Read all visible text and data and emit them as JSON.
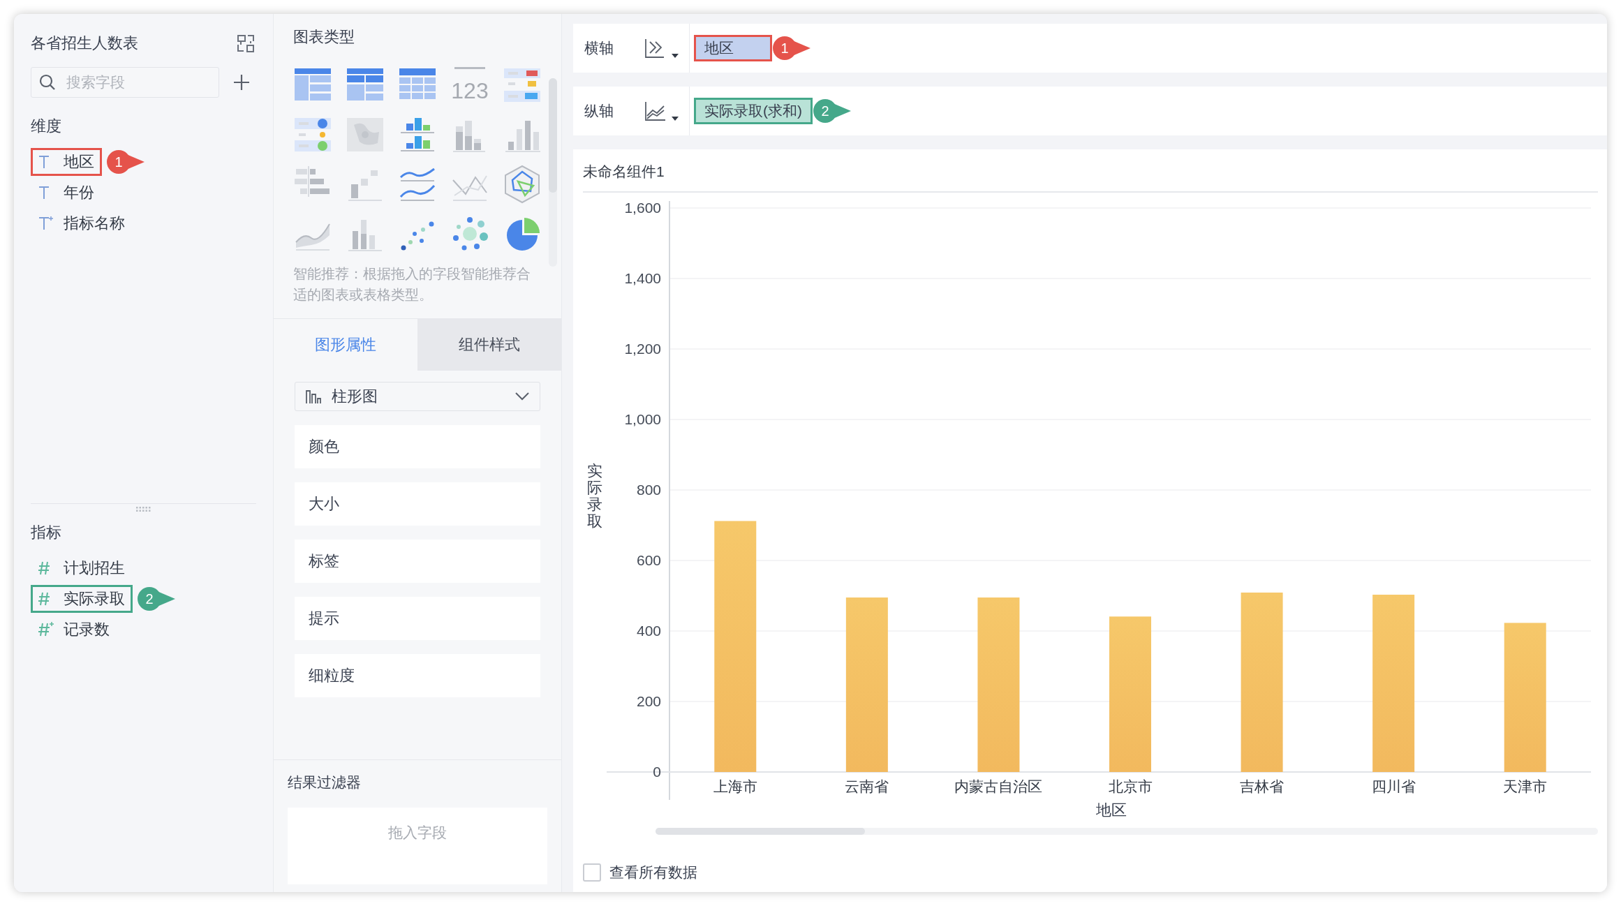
{
  "panel": {
    "title": "各省招生人数表",
    "search": {
      "placeholder": "搜索字段"
    }
  },
  "dimensions": {
    "heading": "维度",
    "items": [
      {
        "label": "地区",
        "kind": "text",
        "callout": {
          "label": "1",
          "color": "#e5534b"
        }
      },
      {
        "label": "年份",
        "kind": "text"
      },
      {
        "label": "指标名称",
        "kind": "text-calc"
      }
    ]
  },
  "measures": {
    "heading": "指标",
    "items": [
      {
        "label": "计划招生",
        "kind": "number"
      },
      {
        "label": "实际录取",
        "kind": "number",
        "callout": {
          "label": "2",
          "color": "#45a88a"
        }
      },
      {
        "label": "记录数",
        "kind": "number-calc"
      }
    ]
  },
  "chart_types": {
    "heading": "图表类型",
    "items": [
      {
        "kind": "grouped-table"
      },
      {
        "kind": "cross-table"
      },
      {
        "kind": "detail-table"
      },
      {
        "kind": "number",
        "label": "123"
      },
      {
        "kind": "number-list"
      },
      {
        "kind": "dot-list"
      },
      {
        "kind": "map"
      },
      {
        "kind": "multi-bar"
      },
      {
        "kind": "bar-gray"
      },
      {
        "kind": "column-gray"
      },
      {
        "kind": "bar-horizontal"
      },
      {
        "kind": "step"
      },
      {
        "kind": "multi-line"
      },
      {
        "kind": "line-gray"
      },
      {
        "kind": "radar"
      },
      {
        "kind": "area"
      },
      {
        "kind": "stacked-gray"
      },
      {
        "kind": "scatter"
      },
      {
        "kind": "bubble"
      },
      {
        "kind": "pie"
      }
    ],
    "hint": "智能推荐：根据拖入的字段智能推荐合适的图表或表格类型。"
  },
  "tabs": [
    {
      "label": "图形属性",
      "selected": true
    },
    {
      "label": "组件样式",
      "selected": false
    }
  ],
  "chart_style": {
    "label": "柱形图"
  },
  "properties": [
    "颜色",
    "大小",
    "标签",
    "提示",
    "细粒度"
  ],
  "filter": {
    "title": "结果过滤器",
    "placeholder": "拖入字段"
  },
  "axes": [
    {
      "label": "横轴",
      "kind": "dimension",
      "field": "地区",
      "callout": {
        "label": "1",
        "color": "#e5534b"
      }
    },
    {
      "label": "纵轴",
      "kind": "measure",
      "field": "实际录取(求和)",
      "callout": {
        "label": "2",
        "color": "#45a88a"
      }
    }
  ],
  "widget": {
    "title": "未命名组件1",
    "chart_data": {
      "type": "bar",
      "xlabel": "地区",
      "ylabel": "实际录取",
      "categories": [
        "上海市",
        "云南省",
        "内蒙古自治区",
        "北京市",
        "吉林省",
        "四川省",
        "天津市"
      ],
      "series": [
        {
          "color": "#f6c86a",
          "values": [
            712,
            495,
            495,
            441,
            509,
            503,
            423
          ]
        }
      ],
      "grid": true,
      "ylim": [
        0,
        1600
      ],
      "yticks": [
        {
          "value": 0,
          "label": "0"
        },
        {
          "value": 200,
          "label": "200"
        },
        {
          "value": 400,
          "label": "400"
        },
        {
          "value": 600,
          "label": "600"
        },
        {
          "value": 800,
          "label": "800"
        },
        {
          "value": 1000,
          "label": "1,000"
        },
        {
          "value": 1200,
          "label": "1,200"
        },
        {
          "value": 1400,
          "label": "1,400"
        },
        {
          "value": 1600,
          "label": "1,600"
        }
      ]
    },
    "view_all": {
      "label": "查看所有数据",
      "checked": false
    }
  }
}
